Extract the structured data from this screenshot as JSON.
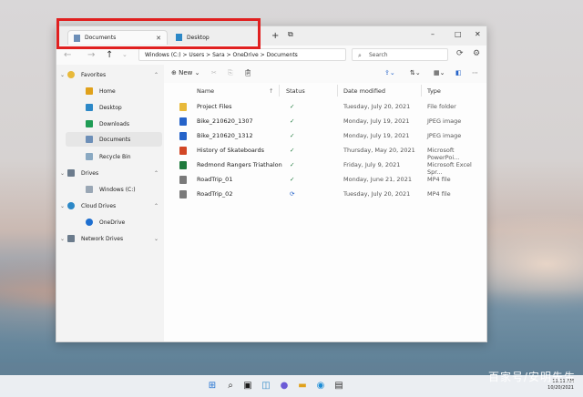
{
  "tabs": [
    {
      "label": "Documents",
      "active": true
    },
    {
      "label": "Desktop",
      "active": false
    }
  ],
  "titlebar": {
    "new_tab": "+",
    "minimize": "–",
    "maximize": "□",
    "close": "✕"
  },
  "address": {
    "path": "Windows (C:)  >  Users  >  Sara  >  OneDrive  >  Documents"
  },
  "search": {
    "placeholder": "Search"
  },
  "toolbar": {
    "new_label": "New"
  },
  "sidebar": {
    "favorites": "Favorites",
    "home": "Home",
    "desktop": "Desktop",
    "downloads": "Downloads",
    "documents": "Documents",
    "recycle": "Recycle Bin",
    "drives": "Drives",
    "windows_c": "Windows (C:)",
    "cloud_drives": "Cloud Drives",
    "onedrive": "OneDrive",
    "network_drives": "Network Drives"
  },
  "columns": {
    "name": "Name",
    "status": "Status",
    "date": "Date modified",
    "type": "Type"
  },
  "files": [
    {
      "name": "Project Files",
      "status": "✓",
      "date": "Tuesday, July 20, 2021",
      "type": "File folder",
      "icon": "folder-icon",
      "color": "#e8b93a"
    },
    {
      "name": "Bike_210620_1307",
      "status": "✓",
      "date": "Monday, July 19, 2021",
      "type": "JPEG image",
      "icon": "image-icon",
      "color": "#2563c9"
    },
    {
      "name": "Bike_210620_1312",
      "status": "✓",
      "date": "Monday, July 19, 2021",
      "type": "JPEG image",
      "icon": "image-icon",
      "color": "#2563c9"
    },
    {
      "name": "History of Skateboards",
      "status": "✓",
      "date": "Thursday, May 20, 2021",
      "type": "Microsoft PowerPoi...",
      "icon": "powerpoint-icon",
      "color": "#d24726"
    },
    {
      "name": "Redmond Rangers Triathalon",
      "status": "✓",
      "date": "Friday, July 9, 2021",
      "type": "Microsoft Excel Spr...",
      "icon": "excel-icon",
      "color": "#1f7a3d"
    },
    {
      "name": "RoadTrip_01",
      "status": "✓",
      "date": "Monday, June 21, 2021",
      "type": "MP4 file",
      "icon": "video-icon",
      "color": "#7a7a7a"
    },
    {
      "name": "RoadTrip_02",
      "status": "⟳",
      "date": "Tuesday, July 20, 2021",
      "type": "MP4 file",
      "icon": "video-icon",
      "color": "#7a7a7a"
    }
  ],
  "clock": {
    "time": "11:11 AM",
    "date": "10/20/2021"
  },
  "watermark": "百家号/安明先生"
}
